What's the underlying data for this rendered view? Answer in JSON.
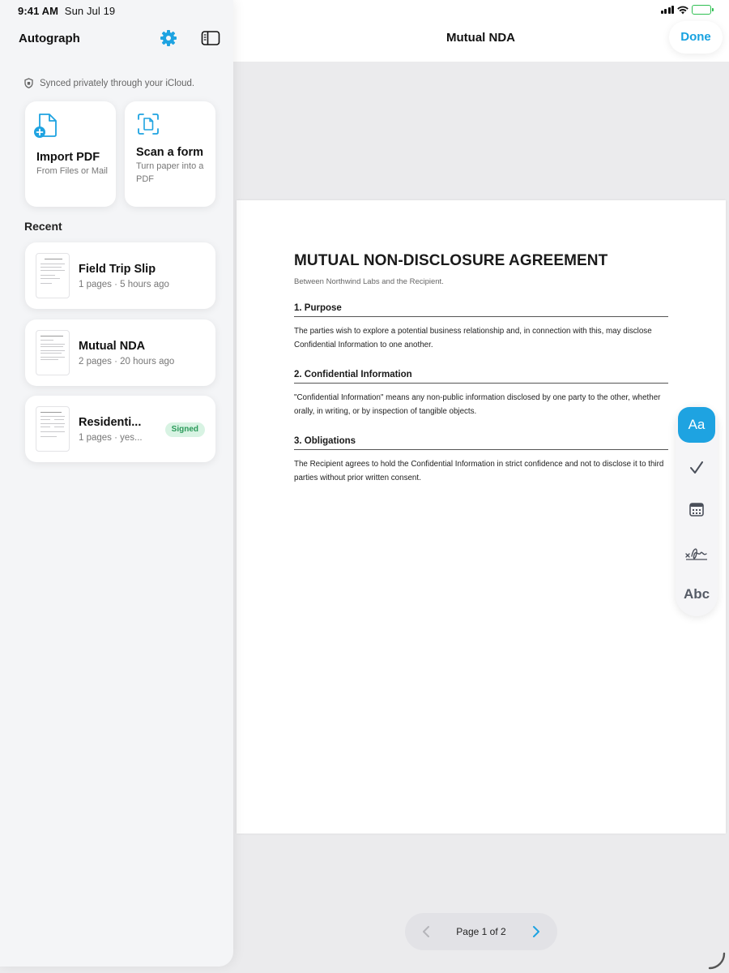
{
  "status_bar": {
    "time": "9:41 AM",
    "date": "Sun Jul 19"
  },
  "sidebar": {
    "app_title": "Autograph",
    "sync_note": "Synced privately through your iCloud.",
    "actions": [
      {
        "title": "Import PDF",
        "subtitle": "From Files or Mail",
        "icon": "file-plus-icon"
      },
      {
        "title": "Scan a form",
        "subtitle": "Turn paper into a PDF",
        "icon": "scan-document-icon"
      }
    ],
    "recent_label": "Recent",
    "recent": [
      {
        "name": "Field Trip Slip",
        "meta": "1 pages · 5 hours ago",
        "badge": ""
      },
      {
        "name": "Mutual NDA",
        "meta": "2 pages · 20 hours ago",
        "badge": ""
      },
      {
        "name": "Residenti...",
        "meta": "1 pages · yes...",
        "badge": "Signed"
      }
    ]
  },
  "viewer": {
    "title": "Mutual NDA",
    "done_label": "Done",
    "accent_color": "#1ea3e1",
    "document": {
      "title": "MUTUAL NON-DISCLOSURE AGREEMENT",
      "subtitle": "Between Northwind Labs and the Recipient.",
      "sections": [
        {
          "heading": "1. Purpose",
          "body": "The parties wish to explore a potential business relationship and, in connection with this, may disclose Confidential Information to one another."
        },
        {
          "heading": "2. Confidential Information",
          "body": "\"Confidential Information\" means any non-public information disclosed by one party to the other, whether orally, in writing, or by inspection of tangible objects."
        },
        {
          "heading": "3. Obligations",
          "body": "The Recipient agrees to hold the Confidential Information in strict confidence and not to disclose it to third parties without prior written consent."
        }
      ]
    },
    "tools": [
      {
        "name": "text-tool",
        "label": "Aa",
        "active": true
      },
      {
        "name": "checkmark-tool",
        "icon": "checkmark-icon"
      },
      {
        "name": "date-tool",
        "icon": "calendar-icon"
      },
      {
        "name": "signature-tool",
        "icon": "signature-icon"
      },
      {
        "name": "initials-tool",
        "label": "Abc"
      }
    ],
    "pager": {
      "label": "Page 1 of 2"
    }
  }
}
